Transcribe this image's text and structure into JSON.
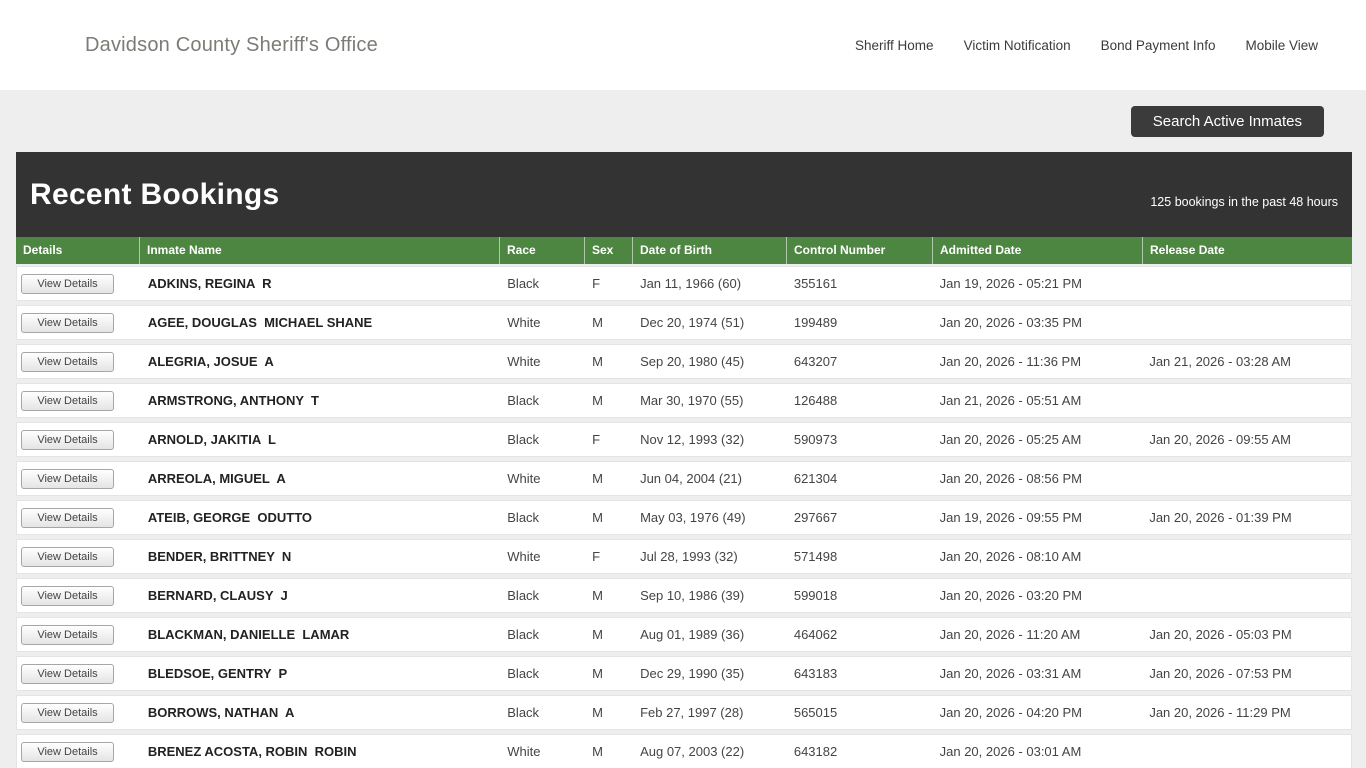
{
  "header": {
    "site_title": "Davidson County Sheriff's Office",
    "nav": [
      {
        "label": "Sheriff Home"
      },
      {
        "label": "Victim Notification"
      },
      {
        "label": "Bond Payment Info"
      },
      {
        "label": "Mobile View"
      }
    ]
  },
  "toolbar": {
    "search_button_label": "Search Active Inmates"
  },
  "bookings": {
    "title": "Recent Bookings",
    "subtitle": "125 bookings in the past 48 hours",
    "view_details_label": "View Details",
    "columns": [
      "Details",
      "Inmate Name",
      "Race",
      "Sex",
      "Date of Birth",
      "Control Number",
      "Admitted Date",
      "Release Date"
    ],
    "rows": [
      {
        "name": "ADKINS, REGINA  R",
        "race": "Black",
        "sex": "F",
        "dob": "Jan 11, 1966 (60)",
        "control": "355161",
        "admitted": "Jan 19, 2026 - 05:21 PM",
        "released": ""
      },
      {
        "name": "AGEE, DOUGLAS  MICHAEL SHANE",
        "race": "White",
        "sex": "M",
        "dob": "Dec 20, 1974 (51)",
        "control": "199489",
        "admitted": "Jan 20, 2026 - 03:35 PM",
        "released": ""
      },
      {
        "name": "ALEGRIA, JOSUE  A",
        "race": "White",
        "sex": "M",
        "dob": "Sep 20, 1980 (45)",
        "control": "643207",
        "admitted": "Jan 20, 2026 - 11:36 PM",
        "released": "Jan 21, 2026 - 03:28 AM"
      },
      {
        "name": "ARMSTRONG, ANTHONY  T",
        "race": "Black",
        "sex": "M",
        "dob": "Mar 30, 1970 (55)",
        "control": "126488",
        "admitted": "Jan 21, 2026 - 05:51 AM",
        "released": ""
      },
      {
        "name": "ARNOLD, JAKITIA  L",
        "race": "Black",
        "sex": "F",
        "dob": "Nov 12, 1993 (32)",
        "control": "590973",
        "admitted": "Jan 20, 2026 - 05:25 AM",
        "released": "Jan 20, 2026 - 09:55 AM"
      },
      {
        "name": "ARREOLA, MIGUEL  A",
        "race": "White",
        "sex": "M",
        "dob": "Jun 04, 2004 (21)",
        "control": "621304",
        "admitted": "Jan 20, 2026 - 08:56 PM",
        "released": ""
      },
      {
        "name": "ATEIB, GEORGE  ODUTTO",
        "race": "Black",
        "sex": "M",
        "dob": "May 03, 1976 (49)",
        "control": "297667",
        "admitted": "Jan 19, 2026 - 09:55 PM",
        "released": "Jan 20, 2026 - 01:39 PM"
      },
      {
        "name": "BENDER, BRITTNEY  N",
        "race": "White",
        "sex": "F",
        "dob": "Jul 28, 1993 (32)",
        "control": "571498",
        "admitted": "Jan 20, 2026 - 08:10 AM",
        "released": ""
      },
      {
        "name": "BERNARD, CLAUSY  J",
        "race": "Black",
        "sex": "M",
        "dob": "Sep 10, 1986 (39)",
        "control": "599018",
        "admitted": "Jan 20, 2026 - 03:20 PM",
        "released": ""
      },
      {
        "name": "BLACKMAN, DANIELLE  LAMAR",
        "race": "Black",
        "sex": "M",
        "dob": "Aug 01, 1989 (36)",
        "control": "464062",
        "admitted": "Jan 20, 2026 - 11:20 AM",
        "released": "Jan 20, 2026 - 05:03 PM"
      },
      {
        "name": "BLEDSOE, GENTRY  P",
        "race": "Black",
        "sex": "M",
        "dob": "Dec 29, 1990 (35)",
        "control": "643183",
        "admitted": "Jan 20, 2026 - 03:31 AM",
        "released": "Jan 20, 2026 - 07:53 PM"
      },
      {
        "name": "BORROWS, NATHAN  A",
        "race": "Black",
        "sex": "M",
        "dob": "Feb 27, 1997 (28)",
        "control": "565015",
        "admitted": "Jan 20, 2026 - 04:20 PM",
        "released": "Jan 20, 2026 - 11:29 PM"
      },
      {
        "name": "BRENEZ ACOSTA, ROBIN  ROBIN",
        "race": "White",
        "sex": "M",
        "dob": "Aug 07, 2003 (22)",
        "control": "643182",
        "admitted": "Jan 20, 2026 - 03:01 AM",
        "released": ""
      }
    ]
  },
  "colors": {
    "accent_green": "#4d8640",
    "band_dark": "#333333",
    "button_dark": "#3b3b3b",
    "page_bg": "#eeeeee"
  }
}
